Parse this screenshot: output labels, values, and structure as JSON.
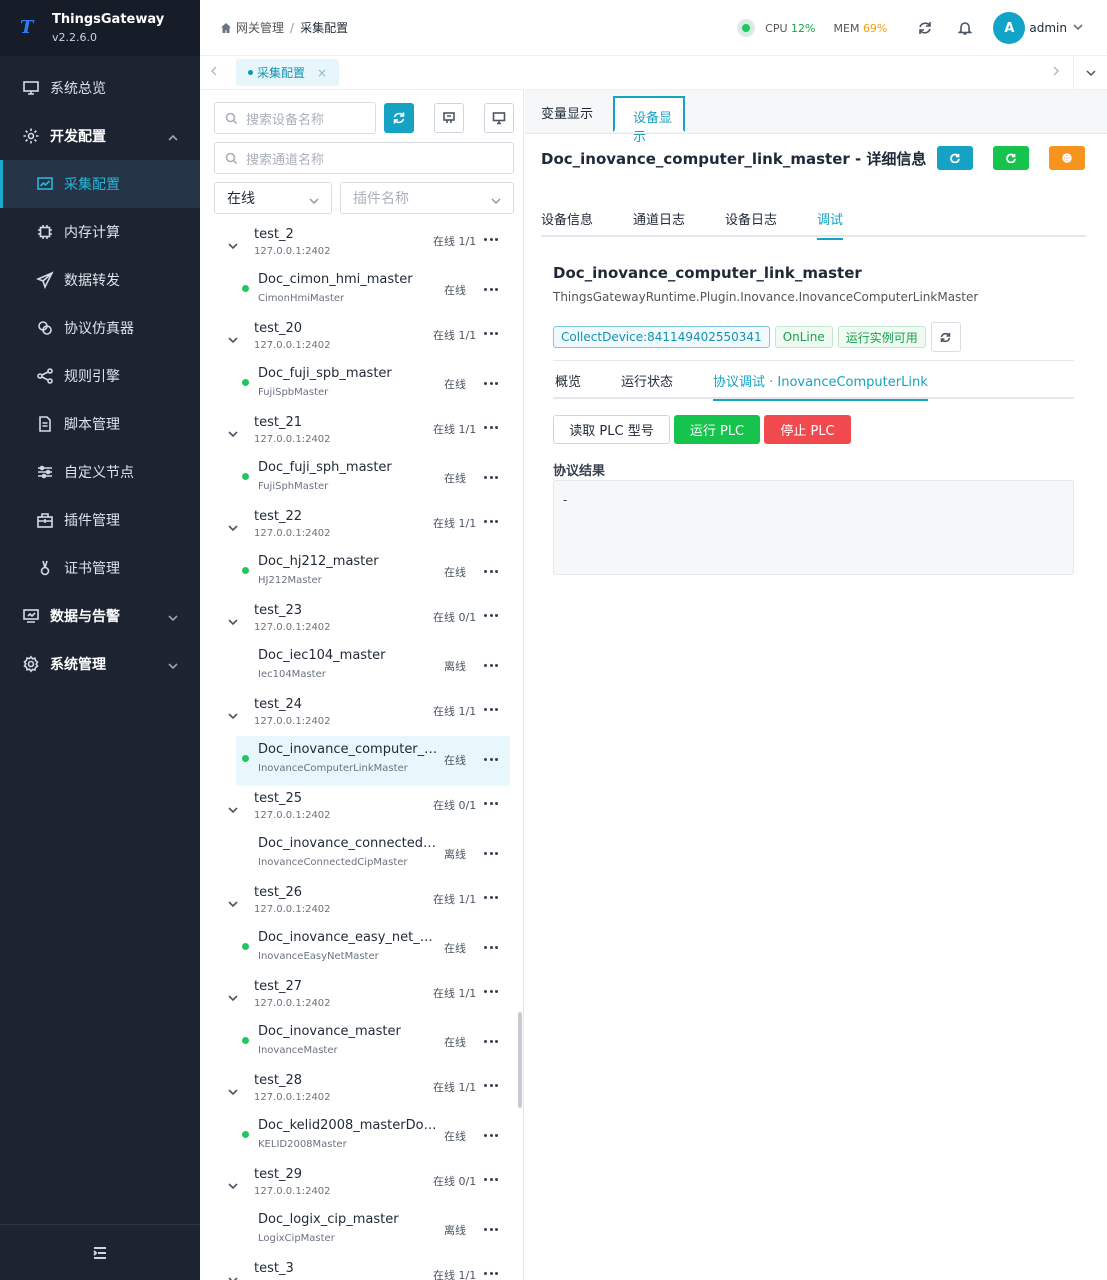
{
  "brand": {
    "name": "ThingsGateway",
    "version": "v2.2.6.0",
    "logo_letter": "T"
  },
  "sidebar": {
    "items": [
      {
        "label": "系统总览",
        "icon": "monitor-icon",
        "type": "top"
      },
      {
        "label": "开发配置",
        "icon": "gear-icon",
        "type": "group",
        "expanded": true
      },
      {
        "label": "采集配置",
        "icon": "chart-icon",
        "type": "sub",
        "active": true
      },
      {
        "label": "内存计算",
        "icon": "chip-icon",
        "type": "sub"
      },
      {
        "label": "数据转发",
        "icon": "send-icon",
        "type": "sub"
      },
      {
        "label": "协议仿真器",
        "icon": "link-icon",
        "type": "sub"
      },
      {
        "label": "规则引擎",
        "icon": "share-icon",
        "type": "sub"
      },
      {
        "label": "脚本管理",
        "icon": "file-icon",
        "type": "sub"
      },
      {
        "label": "自定义节点",
        "icon": "sliders-icon",
        "type": "sub"
      },
      {
        "label": "插件管理",
        "icon": "package-icon",
        "type": "sub"
      },
      {
        "label": "证书管理",
        "icon": "certificate-icon",
        "type": "sub"
      },
      {
        "label": "数据与告警",
        "icon": "dashboard-icon",
        "type": "group",
        "expanded": false
      },
      {
        "label": "系统管理",
        "icon": "settings-icon",
        "type": "group",
        "expanded": false
      }
    ]
  },
  "header": {
    "breadcrumb": [
      "网关管理",
      "采集配置"
    ],
    "cpu_label": "CPU",
    "cpu_value": "12%",
    "mem_label": "MEM",
    "mem_value": "69%",
    "avatar_letter": "A",
    "user": "admin"
  },
  "tabs": {
    "open": [
      {
        "label": "采集配置",
        "close": "×"
      }
    ]
  },
  "tree": {
    "search_device_placeholder": "搜索设备名称",
    "search_channel_placeholder": "搜索通道名称",
    "status_filter": "在线",
    "plugin_filter_placeholder": "插件名称",
    "groups": [
      {
        "name": "test_2",
        "addr": "127.0.0.1:2402",
        "status": "在线 1/1",
        "device": {
          "name": "Doc_cimon_hmi_master",
          "plugin": "CimonHmiMaster",
          "status": "在线",
          "online": true
        }
      },
      {
        "name": "test_20",
        "addr": "127.0.0.1:2402",
        "status": "在线 1/1",
        "device": {
          "name": "Doc_fuji_spb_master",
          "plugin": "FujiSpbMaster",
          "status": "在线",
          "online": true
        }
      },
      {
        "name": "test_21",
        "addr": "127.0.0.1:2402",
        "status": "在线 1/1",
        "device": {
          "name": "Doc_fuji_sph_master",
          "plugin": "FujiSphMaster",
          "status": "在线",
          "online": true
        }
      },
      {
        "name": "test_22",
        "addr": "127.0.0.1:2402",
        "status": "在线 1/1",
        "device": {
          "name": "Doc_hj212_master",
          "plugin": "HJ212Master",
          "status": "在线",
          "online": true
        }
      },
      {
        "name": "test_23",
        "addr": "127.0.0.1:2402",
        "status": "在线 0/1",
        "device": {
          "name": "Doc_iec104_master",
          "plugin": "Iec104Master",
          "status": "离线",
          "online": false
        }
      },
      {
        "name": "test_24",
        "addr": "127.0.0.1:2402",
        "status": "在线 1/1",
        "device": {
          "name": "Doc_inovance_computer_link...",
          "plugin": "InovanceComputerLinkMaster",
          "status": "在线",
          "online": true,
          "active": true
        }
      },
      {
        "name": "test_25",
        "addr": "127.0.0.1:2402",
        "status": "在线 0/1",
        "device": {
          "name": "Doc_inovance_connected_cip...",
          "plugin": "InovanceConnectedCipMaster",
          "status": "离线",
          "online": false
        }
      },
      {
        "name": "test_26",
        "addr": "127.0.0.1:2402",
        "status": "在线 1/1",
        "device": {
          "name": "Doc_inovance_easy_net_mast...",
          "plugin": "InovanceEasyNetMaster",
          "status": "在线",
          "online": true
        }
      },
      {
        "name": "test_27",
        "addr": "127.0.0.1:2402",
        "status": "在线 1/1",
        "device": {
          "name": "Doc_inovance_master",
          "plugin": "InovanceMaster",
          "status": "在线",
          "online": true
        }
      },
      {
        "name": "test_28",
        "addr": "127.0.0.1:2402",
        "status": "在线 1/1",
        "device": {
          "name": "Doc_kelid2008_masterDoc_k...",
          "plugin": "KELID2008Master",
          "status": "在线",
          "online": true
        }
      },
      {
        "name": "test_29",
        "addr": "127.0.0.1:2402",
        "status": "在线 0/1",
        "device": {
          "name": "Doc_logix_cip_master",
          "plugin": "LogixCipMaster",
          "status": "离线",
          "online": false
        }
      },
      {
        "name": "test_3",
        "addr": "",
        "status": "在线 1/1",
        "device": null
      }
    ]
  },
  "main": {
    "view_tabs": [
      "变量显示",
      "设备显示"
    ],
    "detail_title": "Doc_inovance_computer_link_master - 详细信息",
    "detail_tabs": [
      "设备信息",
      "通道日志",
      "设备日志",
      "调试"
    ],
    "device_name": "Doc_inovance_computer_link_master",
    "device_class": "ThingsGatewayRuntime.Plugin.Inovance.InovanceComputerLinkMaster",
    "tags": [
      "CollectDevice:841149402550341",
      "OnLine",
      "运行实例可用"
    ],
    "sub_tabs": [
      "概览",
      "运行状态",
      "协议调试 · InovanceComputerLink"
    ],
    "buttons": {
      "read_model": "读取 PLC 型号",
      "run": "运行 PLC",
      "stop": "停止 PLC"
    },
    "result_label": "协议结果",
    "result_value": "-",
    "colors": {
      "accent": "#16a2c5",
      "green": "#16c44d",
      "red": "#f04a4e",
      "orange": "#f7941d"
    }
  }
}
